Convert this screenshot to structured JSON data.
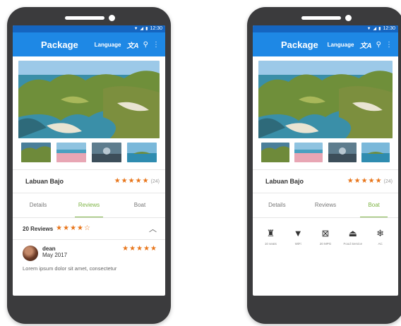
{
  "colors": {
    "accent": "#1e88e5",
    "statusbar": "#1565c0",
    "star": "#e8751a",
    "active_tab": "#7cb342"
  },
  "statusbar": {
    "time": "12:30",
    "icons": [
      "wifi-icon",
      "signal-icon",
      "battery-icon"
    ]
  },
  "appbar": {
    "title": "Package",
    "language_label": "Language",
    "icons": [
      "translate-icon",
      "search-icon",
      "more-vert-icon"
    ]
  },
  "place": {
    "name": "Labuan Bajo",
    "rating": 5,
    "rating_count": "(24)"
  },
  "tabs": {
    "details": "Details",
    "reviews": "Reviews",
    "boat": "Boat"
  },
  "reviews": {
    "header": "20 Reviews",
    "average": 4,
    "items": [
      {
        "name": "dean",
        "date": "May 2017",
        "rating": 5,
        "text": "Lorem ipsum dolor sit amet, consectetur"
      }
    ]
  },
  "amenities": [
    {
      "icon": "seat-icon",
      "label": "10 seats"
    },
    {
      "icon": "wifi-icon",
      "label": "WiFi"
    },
    {
      "icon": "trash-icon",
      "label": "20 MPG"
    },
    {
      "icon": "food-service-icon",
      "label": "Food Service"
    },
    {
      "icon": "ac-icon",
      "label": "AC"
    }
  ]
}
